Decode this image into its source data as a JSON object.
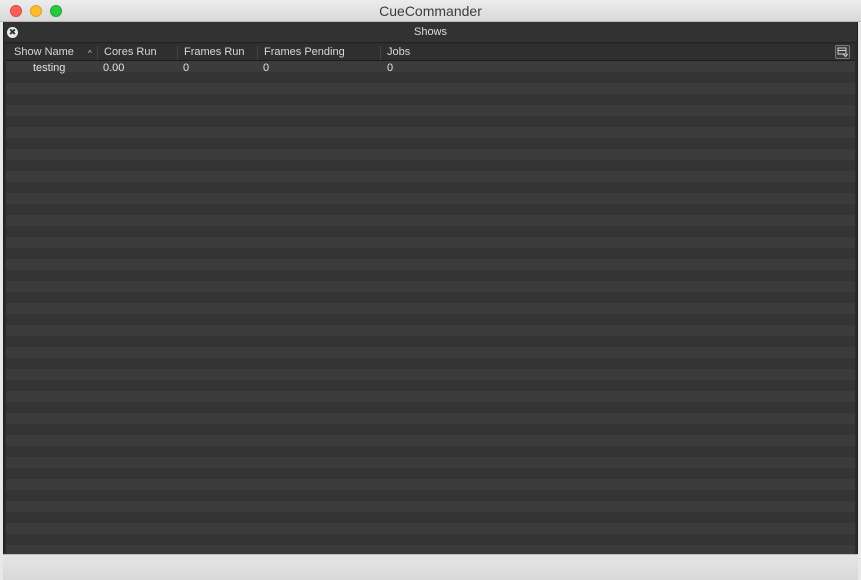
{
  "window": {
    "title": "CueCommander"
  },
  "dock": {
    "title": "Shows",
    "close_glyph": "✖"
  },
  "table": {
    "sort_indicator": "^",
    "columns": [
      "Show Name",
      "Cores Run",
      "Frames Run",
      "Frames Pending",
      "Jobs"
    ],
    "rows": [
      [
        "testing",
        "0.00",
        "0",
        "0",
        "0"
      ]
    ]
  },
  "icons": {
    "dock_close": "close-icon",
    "column_menu": "column-chooser-icon"
  },
  "colors": {
    "close": "#fc5f57",
    "minimize": "#fdbc2e",
    "maximize": "#29c840",
    "panel_bg": "#2b2b2b",
    "row_even": "#3b3b3b",
    "row_odd": "#343434"
  }
}
